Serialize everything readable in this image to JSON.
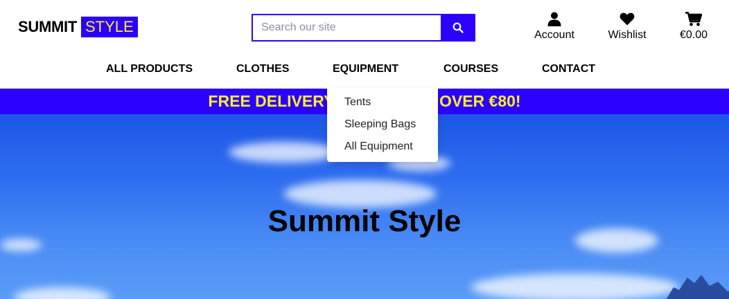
{
  "brand": {
    "part1": "SUMMIT",
    "part2": "STYLE"
  },
  "search": {
    "placeholder": "Search our site",
    "value": ""
  },
  "actions": {
    "account": {
      "label": "Account",
      "icon": "user-icon"
    },
    "wishlist": {
      "label": "Wishlist",
      "icon": "heart-icon"
    },
    "bag": {
      "label": "€0.00",
      "icon": "cart-icon"
    }
  },
  "nav": {
    "items": [
      {
        "label": "ALL PRODUCTS"
      },
      {
        "label": "CLOTHES"
      },
      {
        "label": "EQUIPMENT"
      },
      {
        "label": "COURSES"
      },
      {
        "label": "CONTACT"
      }
    ]
  },
  "dropdown": {
    "items": [
      {
        "label": "Tents"
      },
      {
        "label": "Sleeping Bags"
      },
      {
        "label": "All Equipment"
      }
    ]
  },
  "promo": {
    "text": "FREE DELIVERY ON ORDERS OVER €80!"
  },
  "hero": {
    "title": "Summit Style"
  },
  "colors": {
    "brand_blue": "#2b00ff",
    "brand_yellow": "#ffef2a"
  }
}
